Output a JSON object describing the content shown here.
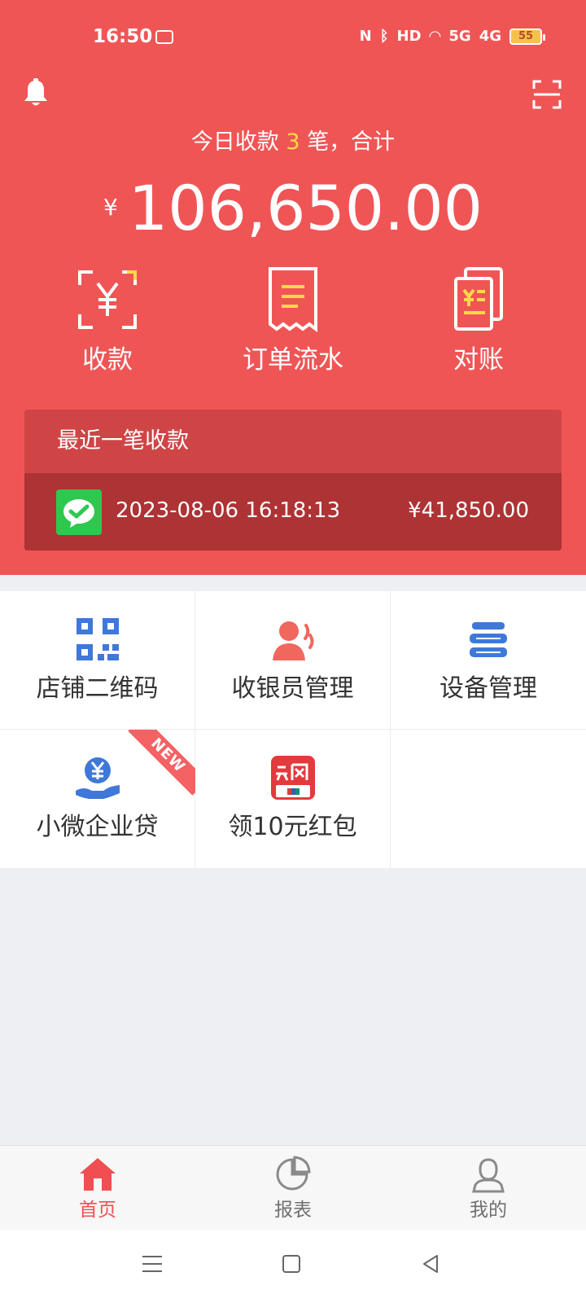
{
  "status_bar": {
    "time": "16:50",
    "icons": [
      "nfc-icon",
      "bluetooth-icon",
      "hd-icon",
      "wifi-icon",
      "5g-signal-icon",
      "4g-signal-icon",
      "battery-icon"
    ],
    "hd_label": "HD",
    "signal_5g_label": "5G",
    "signal_4g_label": "4G",
    "battery_level": "55"
  },
  "header": {
    "summary_prefix": "今日收款",
    "summary_count": "3",
    "summary_suffix": "笔，合计",
    "currency_symbol": "¥",
    "total_amount": "106,650.00",
    "actions": [
      {
        "label": "收款",
        "icon": "collect-payment-icon"
      },
      {
        "label": "订单流水",
        "icon": "order-flow-icon"
      },
      {
        "label": "对账",
        "icon": "reconciliation-icon"
      }
    ],
    "recent": {
      "title": "最近一笔收款",
      "time": "2023-08-06 16:18:13",
      "amount": "¥41,850.00",
      "icon": "wechat-pay-icon"
    }
  },
  "grid": {
    "items": [
      {
        "label": "店铺二维码",
        "icon": "qr-code-icon"
      },
      {
        "label": "收银员管理",
        "icon": "cashier-icon"
      },
      {
        "label": "设备管理",
        "icon": "device-icon"
      },
      {
        "label": "小微企业贷",
        "icon": "loan-icon",
        "badge": "NEW"
      },
      {
        "label": "领10元红包",
        "icon": "unionpay-icon"
      }
    ]
  },
  "tabbar": {
    "items": [
      {
        "label": "首页",
        "icon": "home-icon",
        "active": true
      },
      {
        "label": "报表",
        "icon": "report-icon",
        "active": false
      },
      {
        "label": "我的",
        "icon": "profile-icon",
        "active": false
      }
    ]
  },
  "colors": {
    "header_red": "#f05556",
    "card_red": "#ad3335",
    "accent_yellow": "#ffd84a",
    "blue_icon": "#3f78d8",
    "active_tab_red": "#f04e52"
  }
}
